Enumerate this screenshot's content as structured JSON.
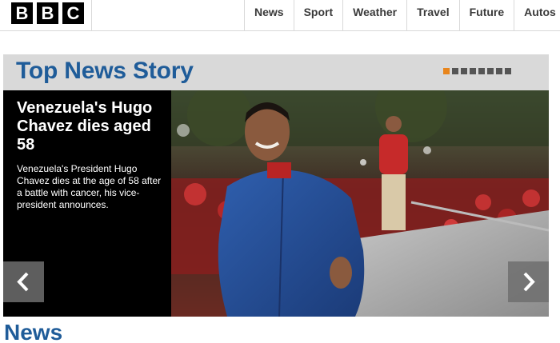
{
  "logo": {
    "letters": [
      "B",
      "B",
      "C"
    ]
  },
  "nav": {
    "items": [
      {
        "label": "News"
      },
      {
        "label": "Sport"
      },
      {
        "label": "Weather"
      },
      {
        "label": "Travel"
      },
      {
        "label": "Future"
      },
      {
        "label": "Autos"
      }
    ]
  },
  "top_story": {
    "section_title": "Top News Story",
    "carousel": {
      "total_slides": 8,
      "active_slide": 1
    },
    "headline": "Venezuela's Hugo Chavez dies aged 58",
    "summary": "Venezuela's President Hugo Chavez dies at the age of 58 after a battle with cancer, his vice-president announces.",
    "prev_icon": "chevron-left-icon",
    "next_icon": "chevron-right-icon"
  },
  "news_section": {
    "title": "News"
  },
  "colors": {
    "brand_blue": "#1f5c99",
    "active_dot": "#e8851c",
    "inactive_dot": "#555555",
    "module_bg": "#d9d9d9"
  }
}
